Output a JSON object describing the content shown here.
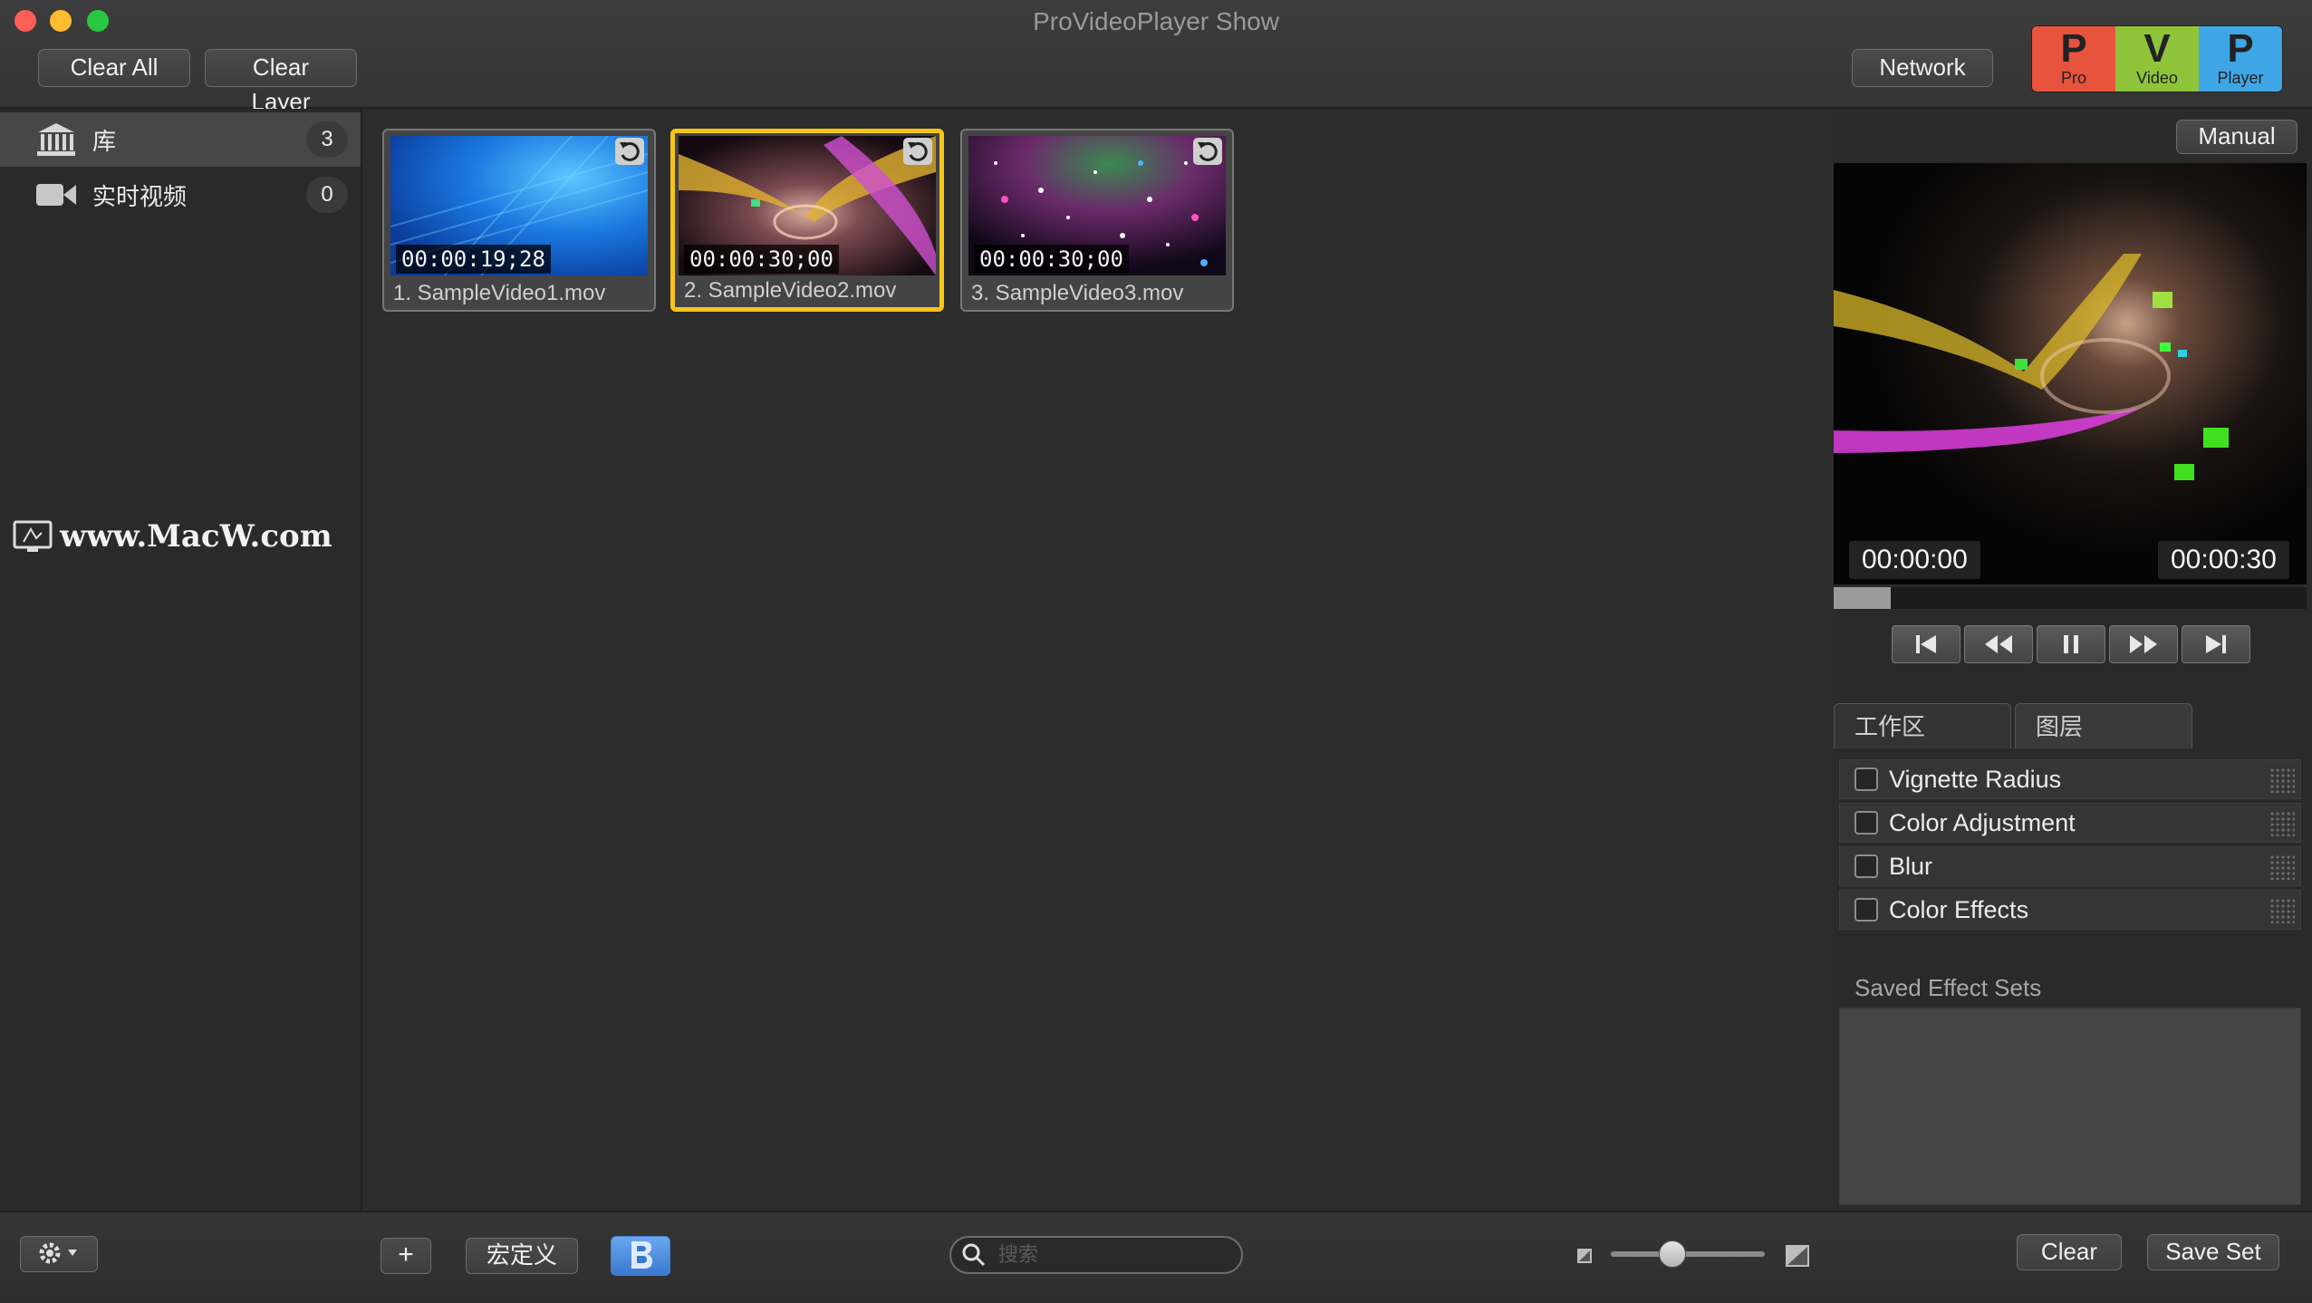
{
  "window": {
    "title": "ProVideoPlayer Show"
  },
  "toolbar": {
    "clear_all_label": "Clear All",
    "clear_layer_label": "Clear Layer",
    "network_label": "Network",
    "logo": [
      {
        "letter": "P",
        "caption": "Pro",
        "color": "#e8533d"
      },
      {
        "letter": "V",
        "caption": "Video",
        "color": "#8fc43a"
      },
      {
        "letter": "P",
        "caption": "Player",
        "color": "#3fa6e6"
      }
    ]
  },
  "sidebar": {
    "items": [
      {
        "label": "库",
        "count": "3",
        "icon": "library-icon",
        "selected": true
      },
      {
        "label": "实时视频",
        "count": "0",
        "icon": "video-camera-icon",
        "selected": false
      }
    ]
  },
  "watermark": {
    "text": "www.MacW.com"
  },
  "media": {
    "items": [
      {
        "timecode": "00:00:19;28",
        "name": "1. SampleVideo1.mov",
        "selected": false
      },
      {
        "timecode": "00:00:30;00",
        "name": "2. SampleVideo2.mov",
        "selected": true
      },
      {
        "timecode": "00:00:30;00",
        "name": "3. SampleVideo3.mov",
        "selected": false
      }
    ]
  },
  "preview": {
    "mode_label": "Manual",
    "time_current": "00:00:00",
    "time_total": "00:00:30",
    "progress": 0.12
  },
  "transport": {
    "buttons": [
      "skip-back-icon",
      "rewind-icon",
      "pause-icon",
      "fast-forward-icon",
      "skip-forward-icon"
    ]
  },
  "tabs": [
    {
      "label": "工作区",
      "active": false
    },
    {
      "label": "图层",
      "active": true
    }
  ],
  "effects": {
    "items": [
      {
        "label": "Vignette Radius",
        "checked": false
      },
      {
        "label": "Color Adjustment",
        "checked": false
      },
      {
        "label": "Blur",
        "checked": false
      },
      {
        "label": "Color Effects",
        "checked": false
      }
    ],
    "saved_title": "Saved Effect Sets"
  },
  "bottom": {
    "add_label": "+",
    "macro_label": "宏定义",
    "search_placeholder": "搜索",
    "zoom_level": 0.4,
    "clear_label": "Clear",
    "save_set_label": "Save Set"
  }
}
